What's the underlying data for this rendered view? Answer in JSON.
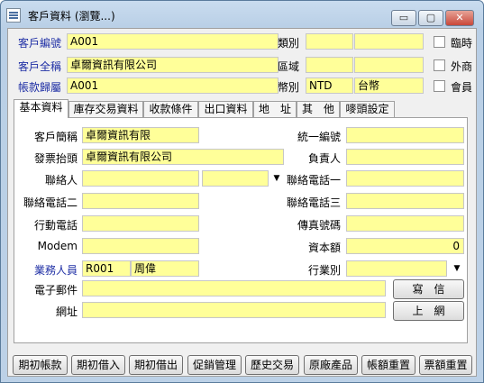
{
  "window": {
    "title": "客戶資料 (瀏覽...)",
    "min": "▭",
    "max": "▢",
    "close": "✕"
  },
  "header": {
    "code_label": "客戶編號",
    "code_value": "A001",
    "fullname_label": "客戶全稱",
    "fullname_value": "卓爾資訊有限公司",
    "account_label": "帳款歸屬",
    "account_value": "A001",
    "category_label": "類別",
    "category_value": "",
    "category_value2": "",
    "region_label": "區域",
    "region_value": "",
    "region_value2": "",
    "currency_label": "幣別",
    "currency_code": "NTD",
    "currency_name": "台幣",
    "chk_temp": "臨時",
    "chk_foreign": "外商",
    "chk_member": "會員"
  },
  "tabs": [
    "基本資料",
    "庫存交易資料",
    "收款條件",
    "出口資料",
    "地　址",
    "其　他",
    "嘜頭設定"
  ],
  "basic": {
    "short_label": "客戶簡稱",
    "short_value": "卓爾資訊有限",
    "invoice_label": "發票抬頭",
    "invoice_value": "卓爾資訊有限公司",
    "contact_label": "聯絡人",
    "contact_value": "",
    "contact_value2": "",
    "phone1_label": "聯絡電話一",
    "phone1_value": "",
    "phone2_label": "聯絡電話二",
    "phone2_value": "",
    "phone3_label": "聯絡電話三",
    "phone3_value": "",
    "mobile_label": "行動電話",
    "mobile_value": "",
    "fax_label": "傳真號碼",
    "fax_value": "",
    "modem_label": "Modem",
    "modem_value": "",
    "capital_label": "資本額",
    "capital_value": "0",
    "sales_label": "業務人員",
    "sales_code": "R001",
    "sales_name": "周偉",
    "industry_label": "行業別",
    "industry_value": "",
    "taxid_label": "統一編號",
    "taxid_value": "",
    "owner_label": "負責人",
    "owner_value": "",
    "email_label": "電子郵件",
    "email_value": "",
    "write_button": "寫　信",
    "url_label": "網址",
    "url_value": "",
    "browse_button": "上　網"
  },
  "bottom_buttons": [
    "期初帳款",
    "期初借入",
    "期初借出",
    "促銷管理",
    "歷史交易",
    "原廠產品",
    "帳額重置",
    "票額重置"
  ],
  "colors": {
    "field": "#ffff99",
    "blue_label": "#1f2fa5"
  }
}
